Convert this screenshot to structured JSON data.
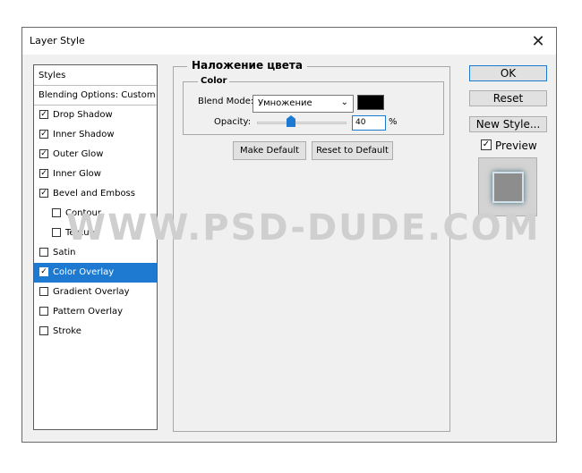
{
  "dialog": {
    "title": "Layer Style",
    "close_glyph": "✕"
  },
  "sidebar": {
    "header": "Styles",
    "blending": "Blending Options: Custom",
    "items": [
      {
        "label": "Drop Shadow",
        "checked": true
      },
      {
        "label": "Inner Shadow",
        "checked": true
      },
      {
        "label": "Outer Glow",
        "checked": true
      },
      {
        "label": "Inner Glow",
        "checked": true
      },
      {
        "label": "Bevel and Emboss",
        "checked": true
      },
      {
        "label": "Contour",
        "checked": false
      },
      {
        "label": "Texture",
        "checked": false
      },
      {
        "label": "Satin",
        "checked": false
      },
      {
        "label": "Color Overlay",
        "checked": true
      },
      {
        "label": "Gradient Overlay",
        "checked": false
      },
      {
        "label": "Pattern Overlay",
        "checked": false
      },
      {
        "label": "Stroke",
        "checked": false
      }
    ]
  },
  "main": {
    "title": "Наложение цвета",
    "group_title": "Color",
    "blend_mode_label": "Blend Mode:",
    "blend_mode_value": "Умножение",
    "overlay_color": "#000000",
    "opacity_label": "Opacity:",
    "opacity_value": "40",
    "opacity_unit": "%",
    "make_default": "Make Default",
    "reset_default": "Reset to Default"
  },
  "right": {
    "ok": "OK",
    "reset": "Reset",
    "new_style": "New Style...",
    "preview_label": "Preview",
    "preview_checked": true
  },
  "watermark": "WWW.PSD-DUDE.COM",
  "accent": "#1e7ad0"
}
